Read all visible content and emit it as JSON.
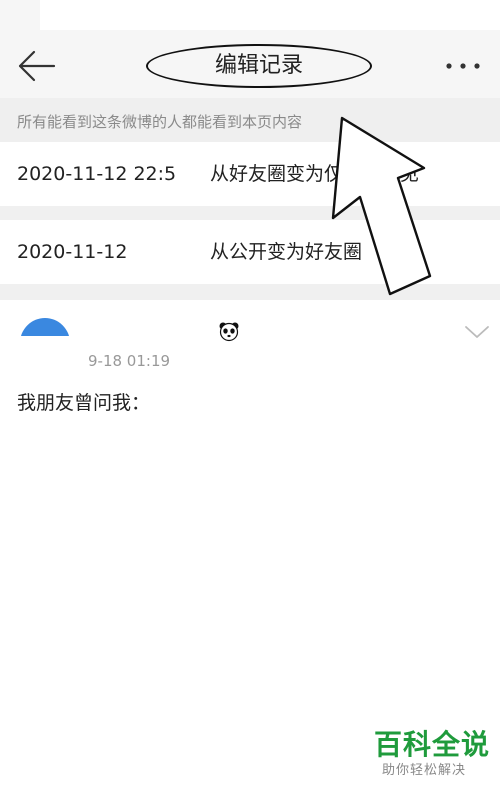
{
  "header": {
    "title": "编辑记录",
    "back_icon": "arrow-left-icon",
    "more_icon": "more-horizontal-icon"
  },
  "notice": "所有能看到这条微博的人都能看到本页内容",
  "records": [
    {
      "date": "2020-11-12 22:5",
      "change": "从好友圈变为仅自己可见"
    },
    {
      "date": "2020-11-12",
      "change": "从公开变为好友圈"
    }
  ],
  "post": {
    "time": "9-18 01:19",
    "text": "我朋友曾问我：",
    "badge_icon": "panda-icon",
    "expand_icon": "chevron-down-icon"
  },
  "watermark": {
    "main": "百科全说",
    "sub": "助你轻松解决"
  },
  "colors": {
    "nav_bg": "#f6f6f6",
    "notice_bg": "#efefef",
    "avatar": "#3a88e0",
    "watermark": "#1f9b3c"
  }
}
